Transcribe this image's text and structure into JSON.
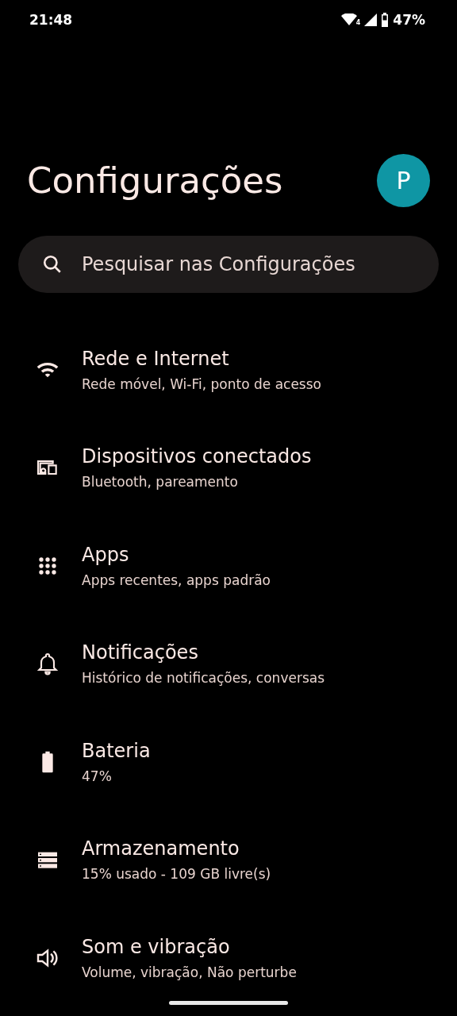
{
  "status_bar": {
    "time": "21:48",
    "network_badge": "4",
    "battery": "47%"
  },
  "title": "Configurações",
  "avatar": "P",
  "search": {
    "placeholder": "Pesquisar nas Configurações"
  },
  "items": [
    {
      "kind": "wifi",
      "title": "Rede e Internet",
      "subtitle": "Rede móvel, Wi-Fi, ponto de acesso"
    },
    {
      "kind": "devices",
      "title": "Dispositivos conectados",
      "subtitle": "Bluetooth, pareamento"
    },
    {
      "kind": "apps",
      "title": "Apps",
      "subtitle": "Apps recentes, apps padrão"
    },
    {
      "kind": "bell",
      "title": "Notificações",
      "subtitle": "Histórico de notificações, conversas"
    },
    {
      "kind": "battery",
      "title": "Bateria",
      "subtitle": "47%"
    },
    {
      "kind": "storage",
      "title": "Armazenamento",
      "subtitle": "15% usado - 109 GB livre(s)"
    },
    {
      "kind": "sound",
      "title": "Som e vibração",
      "subtitle": "Volume, vibração, Não perturbe"
    }
  ]
}
